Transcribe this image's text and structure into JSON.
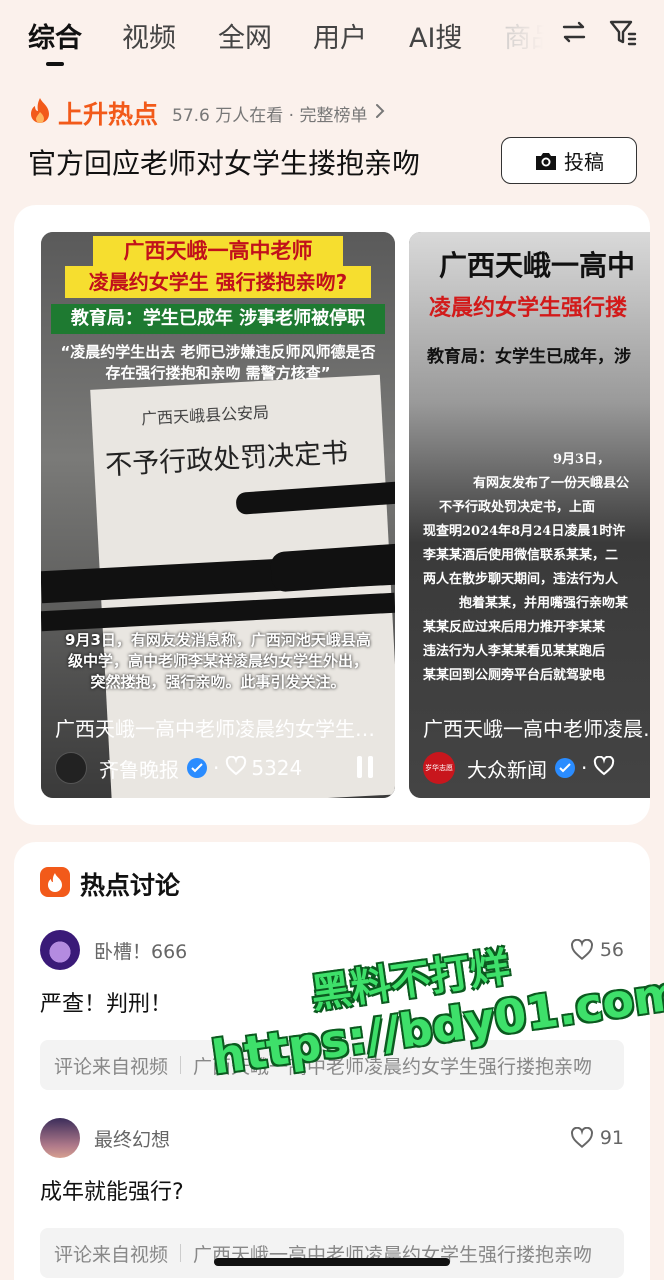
{
  "tabs": {
    "items": [
      "综合",
      "视频",
      "全网",
      "用户",
      "AI搜",
      "商品"
    ]
  },
  "hot": {
    "label": "上升热点",
    "meta": "57.6 万人在看 · 完整榜单",
    "topic_title": "官方回应老师对女学生搂抱亲吻",
    "post_button": "投稿"
  },
  "videos": [
    {
      "banner_line1": "广西天峨一高中老师",
      "banner_line2": "凌晨约女学生 强行搂抱亲吻?",
      "banner_green": "教育局：学生已成年 涉事老师被停职",
      "quote": "“凌晨约学生出去 老师已涉嫌违反师风师德是否存在强行搂抱和亲吻 需警方核查”",
      "doc_org": "广西天峨县公安局",
      "doc_title": "不予行政处罚决定书",
      "caption": "9月3日，有网友发消息称，广西河池天峨县高级中学，高中老师李某祥凌晨约女学生外出，突然搂抱，强行亲吻。此事引发关注。",
      "title": "广西天峨一高中老师凌晨约女学生强行搂抱亲吻",
      "author": "齐鲁晚报",
      "likes": "5324"
    },
    {
      "banner_line1": "广西天峨一高中",
      "banner_line2": "凌晨约女学生强行搂",
      "banner_sub": "教育局：女学生已成年，涉",
      "body_lines": [
        "9月3日，",
        "有网友发布了一份天峨县公",
        "不予行政处罚决定书，上面",
        "现查明2024年8月24日凌晨1时许",
        "李某某酒后使用微信联系某某，二",
        "两人在散步聊天期间，违法行为人",
        "抱着某某，并用嘴强行亲吻某",
        "某某反应过来后用力推开李某某",
        "违法行为人李某某看见某某跑后",
        "某某回到公厕旁平台后就驾驶电"
      ],
      "title": "广西天峨一高中老师凌晨约女学生",
      "author": "大众新闻",
      "avatar_text": "岁华志愿"
    }
  ],
  "discussion": {
    "title": "热点讨论",
    "comments": [
      {
        "user": "卧槽！666",
        "likes": "56",
        "text": "严查！判刑！",
        "source_label": "评论来自视频",
        "source_title": "广西天峨一高中老师凌晨约女学生强行搂抱亲吻"
      },
      {
        "user": "最终幻想",
        "likes": "91",
        "text": "成年就能强行?",
        "source_label": "评论来自视频",
        "source_title": "广西天峨一高中老师凌晨约女学生强行搂抱亲吻"
      }
    ]
  },
  "watermark": {
    "line1": "黑料不打烊",
    "line2": "https://bdy01.com"
  },
  "colors": {
    "accent": "#f25a1a",
    "verified": "#2a8cff",
    "background": "#fbf1ec"
  }
}
